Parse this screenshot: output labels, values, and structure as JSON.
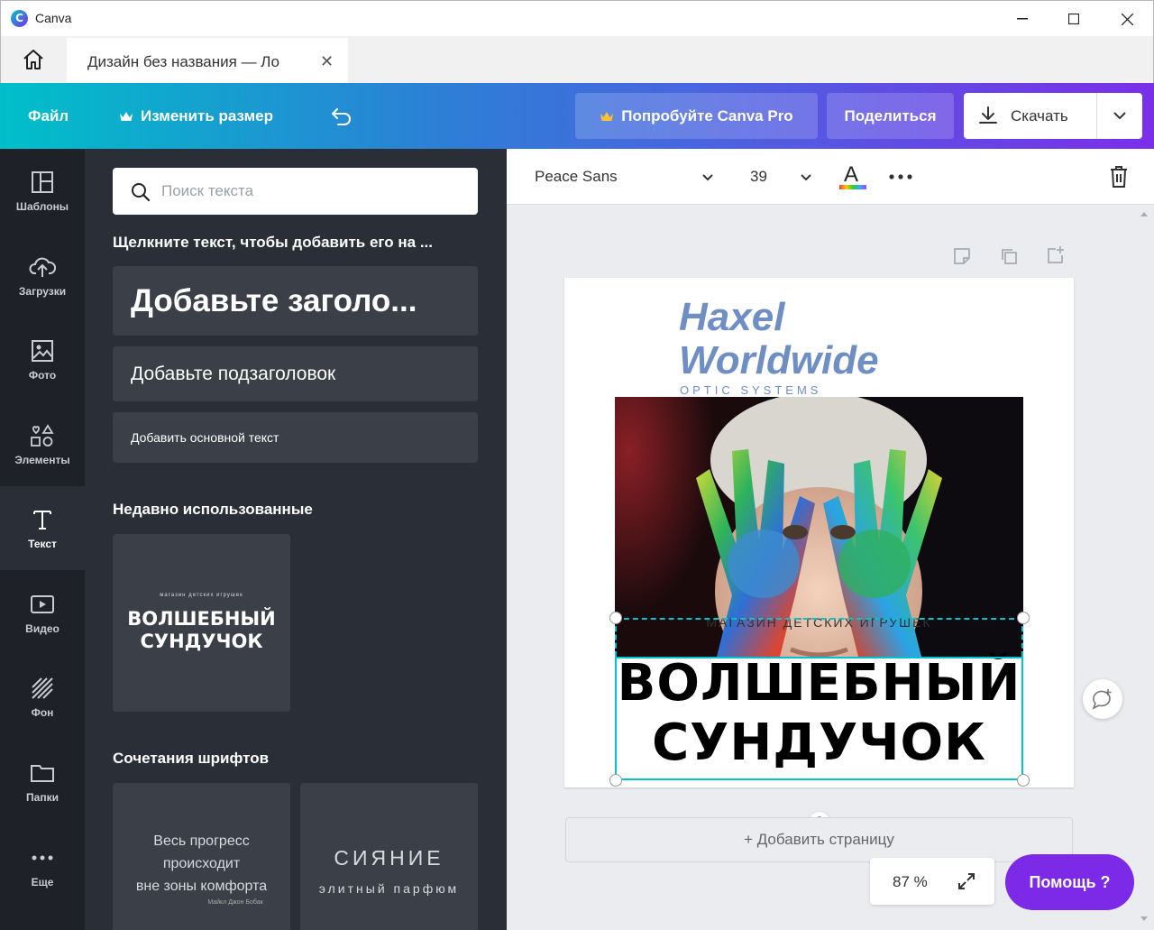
{
  "window": {
    "app_title": "Canva",
    "logo_letter": "C"
  },
  "tab": {
    "title": "Дизайн без названия — Ло",
    "close": "✕"
  },
  "topbar": {
    "file": "Файл",
    "resize": "Изменить размер",
    "try_pro": "Попробуйте Canva Pro",
    "share": "Поделиться",
    "download": "Скачать"
  },
  "rail": {
    "items": [
      {
        "label": "Шаблоны",
        "icon": "layout-icon"
      },
      {
        "label": "Загрузки",
        "icon": "cloud-upload-icon"
      },
      {
        "label": "Фото",
        "icon": "photo-icon"
      },
      {
        "label": "Элементы",
        "icon": "shapes-icon"
      },
      {
        "label": "Текст",
        "icon": "text-icon",
        "active": true
      },
      {
        "label": "Видео",
        "icon": "video-icon"
      },
      {
        "label": "Фон",
        "icon": "background-icon"
      },
      {
        "label": "Папки",
        "icon": "folder-icon"
      },
      {
        "label": "Еще",
        "icon": "more-icon"
      }
    ]
  },
  "panel": {
    "search_placeholder": "Поиск текста",
    "click_hint": "Щелкните текст, чтобы добавить его на ...",
    "add_heading": "Добавьте заголо...",
    "add_subheading": "Добавьте подзаголовок",
    "add_body": "Добавить основной текст",
    "recent_title": "Недавно использованные",
    "recent_card": {
      "small": "магазин детских игрушек",
      "line1": "ВОЛШЕБНЫЙ",
      "line2": "СУНДУЧОК"
    },
    "combos_title": "Сочетания шрифтов",
    "combo1": {
      "line1": "Весь прогресс",
      "line2": "происходит",
      "line3": "вне зоны комфорта",
      "author": "Майкл Джон Бобак"
    },
    "combo2": {
      "line1": "СИЯНИЕ",
      "line2": "элитный парфюм"
    }
  },
  "toolbar": {
    "font_name": "Peace Sans",
    "font_size": "39",
    "text_color_letter": "A"
  },
  "canvas": {
    "brand_line1": "Haxel",
    "brand_line2": "Worldwide",
    "brand_sub": "OPTIC SYSTEMS",
    "small_text": "МАГАЗИН ДЕТСКИХ ИГРУШЕК",
    "big_line1": "ВОЛШЕБНЫЙ",
    "big_line2": "СУНДУЧОК"
  },
  "add_page": "+ Добавить страницу",
  "zoom": {
    "value": "87 %"
  },
  "help": {
    "label": "Помощь  ?"
  },
  "colors": {
    "accent_purple": "#7d2ae8",
    "brand_blue": "#6f8fc4",
    "selection_cyan": "#00c4cc",
    "panel_bg": "#2a2e36"
  }
}
